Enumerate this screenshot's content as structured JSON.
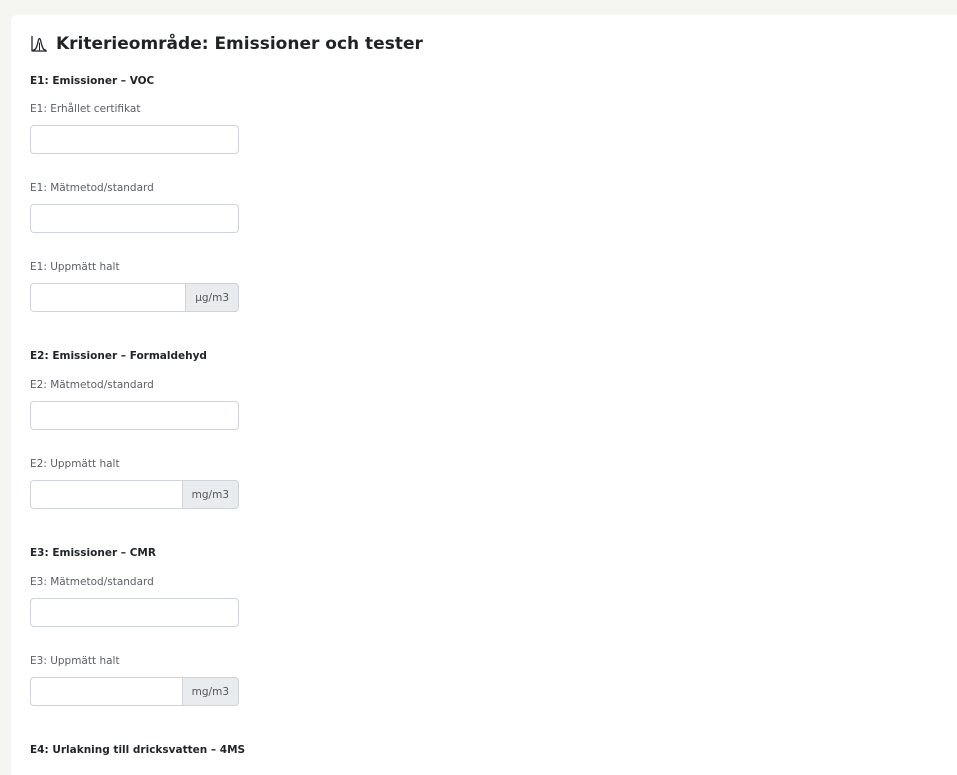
{
  "header": {
    "title": "Kriterieområde: Emissioner och tester",
    "icon": "chart-peak-icon"
  },
  "sections": [
    {
      "heading": "E1: Emissioner – VOC",
      "fields": [
        {
          "label": "E1: Erhållet certifikat",
          "value": "",
          "unit": ""
        },
        {
          "label": "E1: Mätmetod/standard",
          "value": "",
          "unit": ""
        },
        {
          "label": "E1: Uppmätt halt",
          "value": "",
          "unit": "µg/m3"
        }
      ]
    },
    {
      "heading": "E2: Emissioner – Formaldehyd",
      "fields": [
        {
          "label": "E2: Mätmetod/standard",
          "value": "",
          "unit": ""
        },
        {
          "label": "E2: Uppmätt halt",
          "value": "",
          "unit": "mg/m3"
        }
      ]
    },
    {
      "heading": "E3: Emissioner – CMR",
      "fields": [
        {
          "label": "E3: Mätmetod/standard",
          "value": "",
          "unit": ""
        },
        {
          "label": "E3: Uppmätt halt",
          "value": "",
          "unit": "mg/m3"
        }
      ]
    },
    {
      "heading": "E4: Urlakning till dricksvatten – 4MS",
      "fields": []
    }
  ],
  "colors": {
    "page_bg": "#f5f5f2",
    "card_bg": "#ffffff",
    "border": "#ced4da",
    "addon_bg": "#e9ecef"
  }
}
